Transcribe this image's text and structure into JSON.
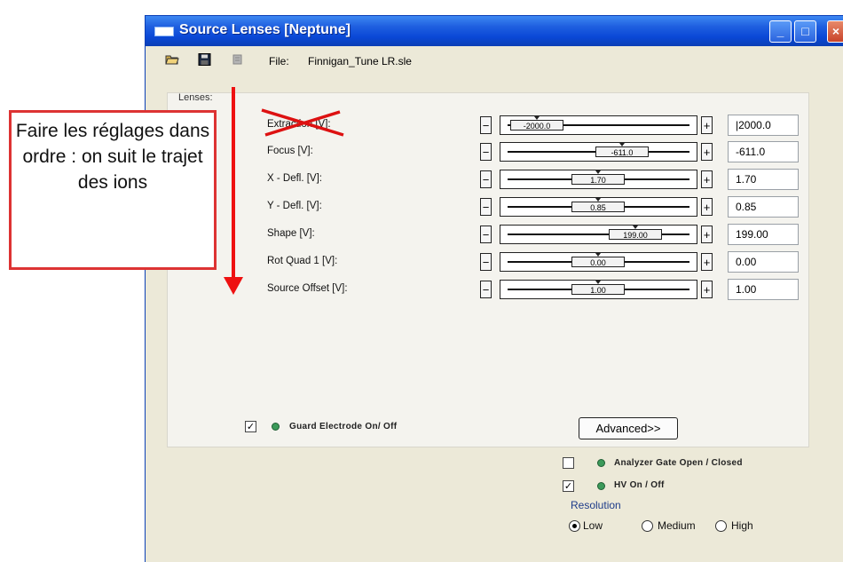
{
  "window": {
    "title": "Source Lenses [Neptune]",
    "controls": [
      "minimize-icon",
      "maximize-icon",
      "close-icon"
    ]
  },
  "toolbar": {
    "icons": [
      "open-folder-icon",
      "save-icon",
      "print-icon"
    ],
    "file_label": "File:",
    "file_name": "Finnigan_Tune LR.sle"
  },
  "lenses": {
    "label": "Lenses:",
    "rows": [
      {
        "label": "Extraction [V]:",
        "slider_text": "-2000.0",
        "value": "|2000.0",
        "slider_fraction": 0.02,
        "crossed_out": true
      },
      {
        "label": "Focus [V]:",
        "slider_text": "-611.0",
        "value": "-611.0",
        "slider_fraction": 0.69
      },
      {
        "label": "X - Defl. [V]:",
        "slider_text": "1.70",
        "value": "1.70",
        "slider_fraction": 0.5
      },
      {
        "label": "Y - Defl. [V]:",
        "slider_text": "0.85",
        "value": "0.85",
        "slider_fraction": 0.5
      },
      {
        "label": "Shape [V]:",
        "slider_text": "199.00",
        "value": "199.00",
        "slider_fraction": 0.8
      },
      {
        "label": "Rot Quad 1 [V]:",
        "slider_text": "0.00",
        "value": "0.00",
        "slider_fraction": 0.5
      },
      {
        "label": "Source Offset [V]:",
        "slider_text": "1.00",
        "value": "1.00",
        "slider_fraction": 0.5
      }
    ],
    "minus_label": "−",
    "plus_label": "+"
  },
  "guard": {
    "label": "Guard Electrode On/ Off",
    "checked": true
  },
  "advanced": {
    "label": "Advanced>>"
  },
  "analyzer_gate": {
    "label": "Analyzer Gate Open / Closed",
    "checked": false
  },
  "hv": {
    "label": "HV On / Off",
    "checked": true
  },
  "resolution": {
    "title": "Resolution",
    "options": [
      "Low",
      "Medium",
      "High"
    ],
    "selected": "Low"
  },
  "annotation": {
    "text": "Faire les réglages dans ordre : on suit le trajet des ions",
    "color": "#dd1111"
  },
  "colors": {
    "titlebar": "#0a48d6",
    "led": "#3c9a5a",
    "annotation_red": "#dd1111"
  }
}
